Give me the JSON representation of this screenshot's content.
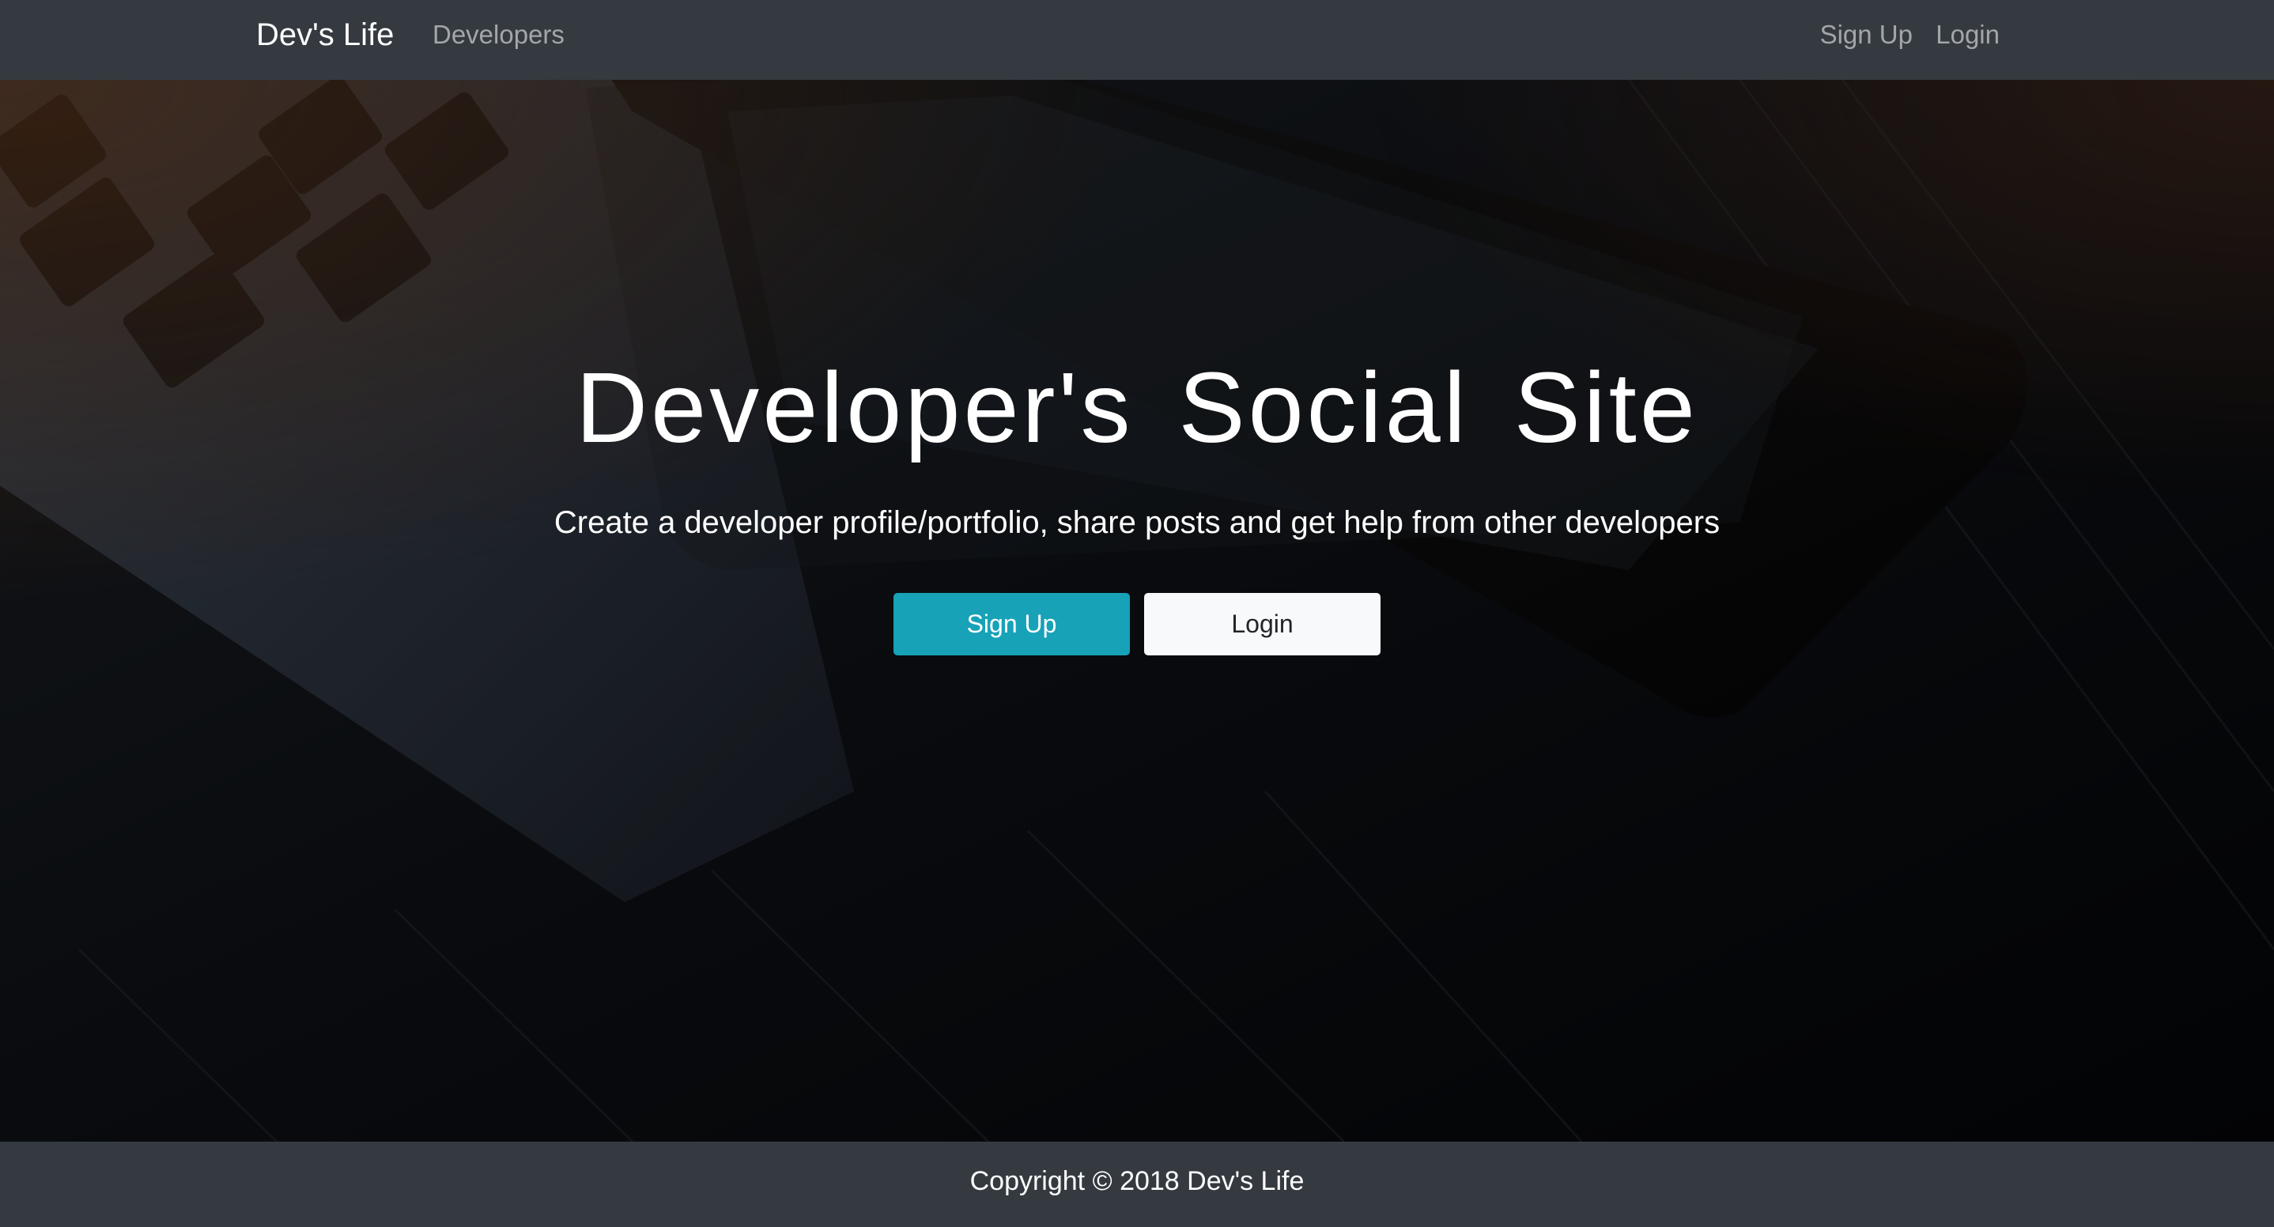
{
  "navbar": {
    "brand": "Dev's Life",
    "links": {
      "developers": "Developers",
      "sign_up": "Sign Up",
      "login": "Login"
    }
  },
  "hero": {
    "title": "Developer's Social Site",
    "lead": "Create a developer profile/portfolio, share posts and get help from other developers",
    "buttons": {
      "sign_up": "Sign Up",
      "login": "Login"
    },
    "background": "photo-laptop-and-tablet-on-wooden-desk"
  },
  "footer": {
    "text": "Copyright © 2018 Dev's Life"
  },
  "colors": {
    "navbar_bg": "#343a40",
    "primary_button": "#17a2b8",
    "light_button": "#f8f9fa"
  }
}
